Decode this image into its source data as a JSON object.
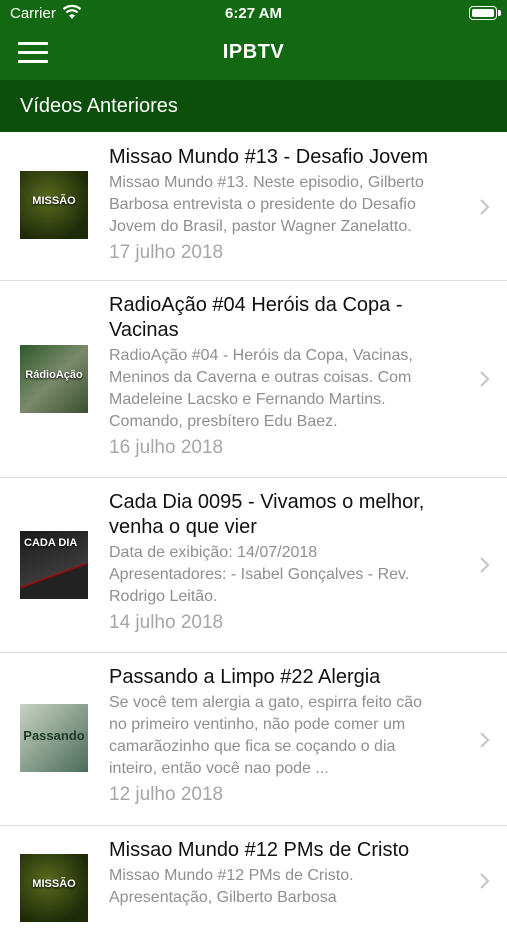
{
  "status_bar": {
    "carrier": "Carrier",
    "time": "6:27 AM"
  },
  "navbar": {
    "title": "IPBTV",
    "menu_icon": "hamburger-menu-icon"
  },
  "section": {
    "label": "Vídeos Anteriores"
  },
  "colors": {
    "bar": "#126912",
    "section": "#0b4f0b",
    "text": "#111111",
    "subtext": "#8e8e93"
  },
  "videos": [
    {
      "title_lines": [
        "Missao Mundo #13 - Desafio Jovem"
      ],
      "desc_lines": [
        "Missao Mundo #13. Neste episodio, Gilberto",
        "Barbosa entrevista o presidente do Desafio",
        "Jovem do Brasil, pastor Wagner Zanelatto."
      ],
      "date": "17 julho 2018"
    },
    {
      "title_lines": [
        "RadioAção #04 Heróis da Copa -",
        "Vacinas"
      ],
      "desc_lines": [
        "RadioAção #04 - Heróis da Copa, Vacinas,",
        "Meninos da Caverna e outras coisas. Com",
        "Madeleine Lacsko e Fernando Martins.",
        "Comando, presbítero Edu Baez."
      ],
      "date": "16 julho 2018"
    },
    {
      "title_lines": [
        "Cada Dia 0095 - Vivamos o melhor,",
        "venha o que vier"
      ],
      "desc_lines": [
        "Data de exibição: 14/07/2018",
        "Apresentadores: - Isabel Gonçalves - Rev.",
        "Rodrigo Leitão."
      ],
      "date": "14 julho 2018"
    },
    {
      "title_lines": [
        "Passando a Limpo #22 Alergia"
      ],
      "desc_lines": [
        "Se você tem alergia a gato, espirra feito cão",
        "no primeiro ventinho, não pode comer um",
        "camarãozinho que fica se coçando o dia",
        "inteiro, então você nao pode ..."
      ],
      "date": "12 julho 2018"
    },
    {
      "title_lines": [
        "Missao Mundo #12 PMs de Cristo"
      ],
      "desc_lines": [
        "Missao Mundo #12 PMs de Cristo.",
        "Apresentação, Gilberto Barbosa"
      ],
      "date": ""
    }
  ],
  "thumbnails": [
    "MISSÃO",
    "RádioAção",
    "CADA DIA",
    "Passando",
    "MISSÃO"
  ]
}
